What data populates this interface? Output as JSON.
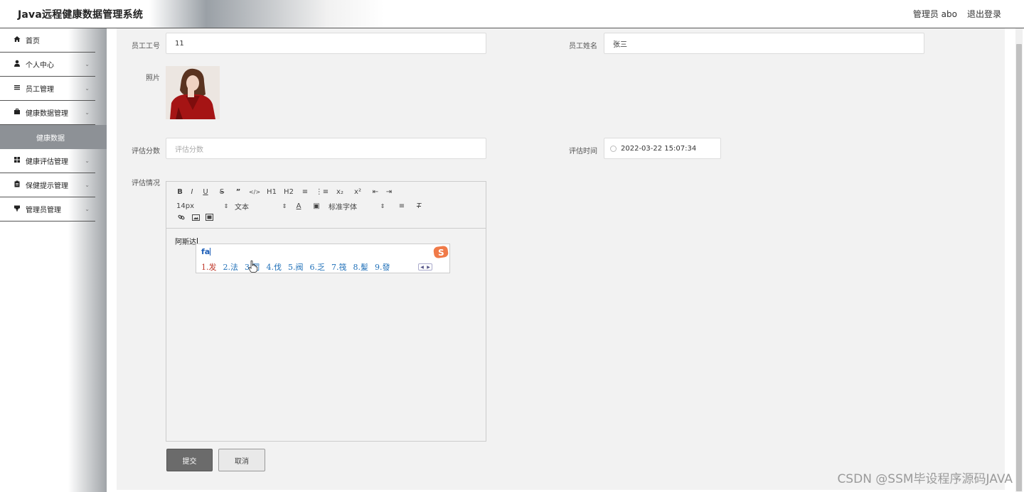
{
  "header": {
    "title": "Java远程健康数据管理系统",
    "user": "管理员 abo",
    "logout": "退出登录"
  },
  "sidebar": {
    "items": [
      {
        "label": "首页",
        "icon": "home-icon"
      },
      {
        "label": "个人中心",
        "icon": "user-icon"
      },
      {
        "label": "员工管理",
        "icon": "list-icon"
      },
      {
        "label": "健康数据管理",
        "icon": "briefcase-icon"
      },
      {
        "label": "健康评估管理",
        "icon": "grid-icon"
      },
      {
        "label": "保健提示管理",
        "icon": "clipboard-icon"
      },
      {
        "label": "管理员管理",
        "icon": "tag-icon"
      }
    ],
    "active_sub": "健康数据"
  },
  "form": {
    "emp_id_label": "员工工号",
    "emp_id_value": "11",
    "emp_name_label": "员工姓名",
    "emp_name_value": "张三",
    "photo_label": "照片",
    "score_label": "评估分数",
    "score_placeholder": "评估分数",
    "time_label": "评估时间",
    "time_value": "2022-03-22 15:07:34",
    "desc_label": "评估情况"
  },
  "editor": {
    "font_size": "14px",
    "text_type": "文本",
    "font_family": "标准字体",
    "headings": [
      "H1",
      "H2"
    ],
    "content": "阿斯达"
  },
  "ime": {
    "input": "fa",
    "candidates": [
      "1.发",
      "2.法",
      "3.罚",
      "4.伐",
      "5.阀",
      "6.乏",
      "7.筏",
      "8.髪",
      "9.發"
    ]
  },
  "buttons": {
    "submit": "提交",
    "cancel": "取消"
  },
  "watermark": "CSDN @SSM毕设程序源码JAVA",
  "colors": {
    "sidebar_active": "#8d9196",
    "submit_bg": "#6b6b6b",
    "ime_blue": "#1e6fb8",
    "ime_red": "#c0392b"
  }
}
